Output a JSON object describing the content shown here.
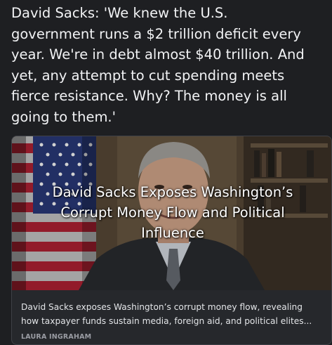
{
  "post": {
    "lines": [
      "David Sacks: 'We knew the U.S.",
      "government runs a $2 trillion deficit every",
      "year. We're in debt almost $40 trillion. And",
      "yet, any attempt to cut spending meets",
      "fierce resistance. Why? The money is all",
      "going to them.'"
    ]
  },
  "card": {
    "title_lines": [
      "David Sacks Exposes Washington’s",
      "Corrupt Money Flow and Political",
      "Influence"
    ],
    "description_lines": [
      "David Sacks exposes Washington’s corrupt money flow, revealing",
      "how taxpayer funds sustain media, foreign aid, and political elites..."
    ],
    "source": "LAURA INGRAHAM"
  }
}
